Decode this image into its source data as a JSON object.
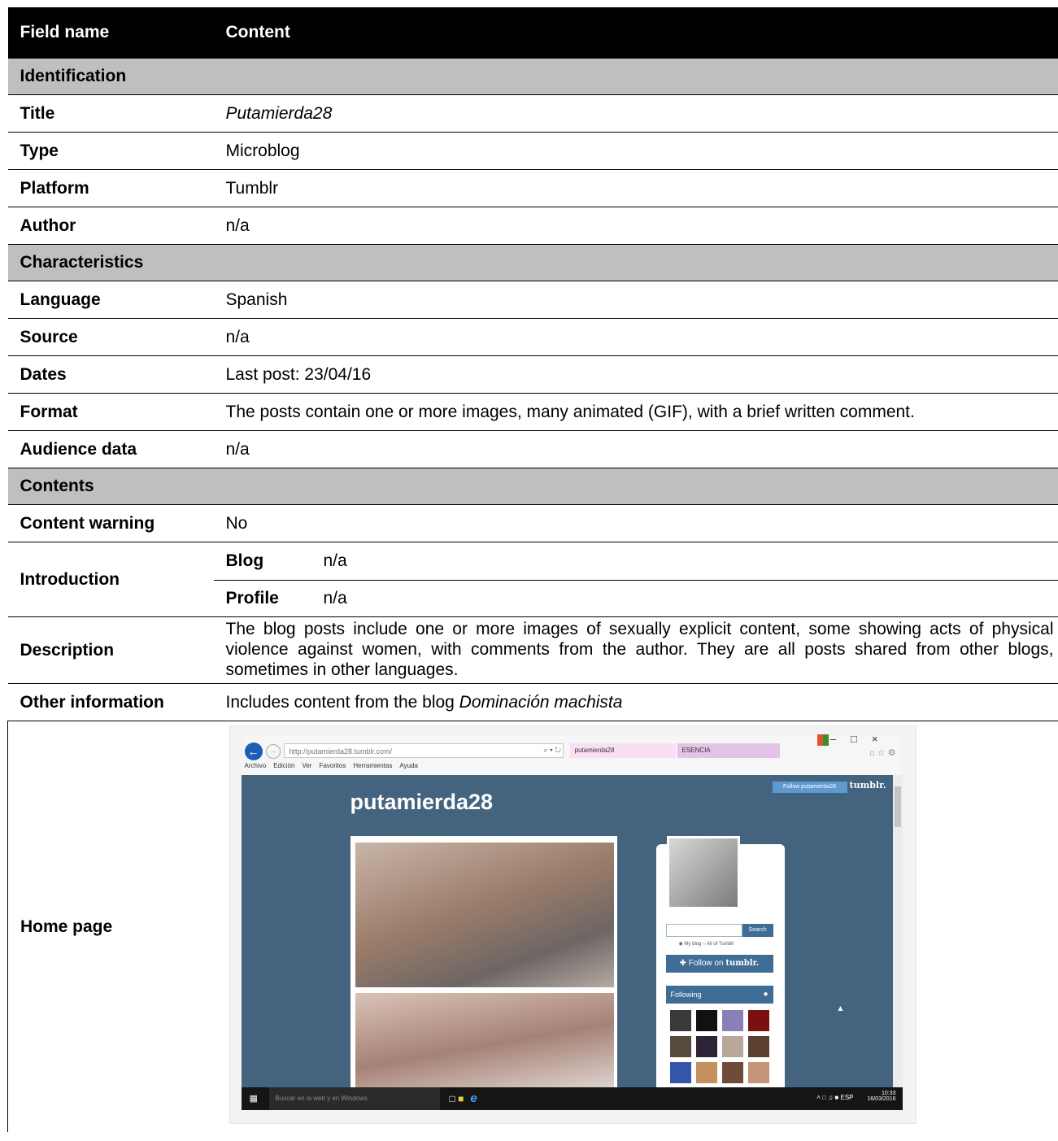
{
  "table": {
    "header": {
      "field": "Field name",
      "content": "Content"
    },
    "sections": {
      "identification": "Identification",
      "characteristics": "Characteristics",
      "contents": "Contents"
    },
    "rows": {
      "title": {
        "label": "Title",
        "value": "Putamierda28"
      },
      "type": {
        "label": "Type",
        "value": "Microblog"
      },
      "platform": {
        "label": "Platform",
        "value": "Tumblr"
      },
      "author": {
        "label": "Author",
        "value": "n/a"
      },
      "language": {
        "label": "Language",
        "value": "Spanish"
      },
      "source": {
        "label": "Source",
        "value": "n/a"
      },
      "dates": {
        "label": "Dates",
        "value": "Last post: 23/04/16"
      },
      "format": {
        "label": "Format",
        "value": "The posts contain one or more images, many animated (GIF), with a brief written comment."
      },
      "audience": {
        "label": "Audience data",
        "value": "n/a"
      },
      "warning": {
        "label": "Content warning",
        "value": "No"
      },
      "introduction": {
        "label": "Introduction",
        "blog_label": "Blog",
        "blog_value": "n/a",
        "profile_label": "Profile",
        "profile_value": "n/a"
      },
      "description": {
        "label": "Description",
        "value": "The blog posts include one or more images of sexually explicit content, some showing acts of physical violence against women, with comments from the author. They are all posts shared from other blogs, sometimes in other languages."
      },
      "other": {
        "label": "Other information",
        "prefix": "Includes content from the blog ",
        "blog_name": "Dominación machista"
      },
      "home": {
        "label": "Home page"
      }
    }
  },
  "screenshot": {
    "url": "http://putamierda28.tumblr.com/",
    "tab1": "putamierda28",
    "tab2": "ESENCIA",
    "menu": [
      "Archivo",
      "Edición",
      "Ver",
      "Favoritos",
      "Herramientas",
      "Ayuda"
    ],
    "blog_title": "putamierda28",
    "follow_small": "Follow putamierda28",
    "tumblr_logo": "tumblr.",
    "search_button": "Search",
    "radio_my_blog": "My blog",
    "radio_all": "All of Tumblr",
    "follow_on": "Follow on",
    "follow_tumblr": "tumblr.",
    "following": "Following",
    "taskbar_search": "Buscar en la web y en Windows",
    "tray_lang": "ESP",
    "tray_time": "10:33",
    "tray_date": "16/03/2016",
    "icons": [
      "back-icon",
      "forward-icon",
      "windows-logo-icon",
      "user-icon",
      "start-icon",
      "internet-explorer-icon"
    ]
  }
}
